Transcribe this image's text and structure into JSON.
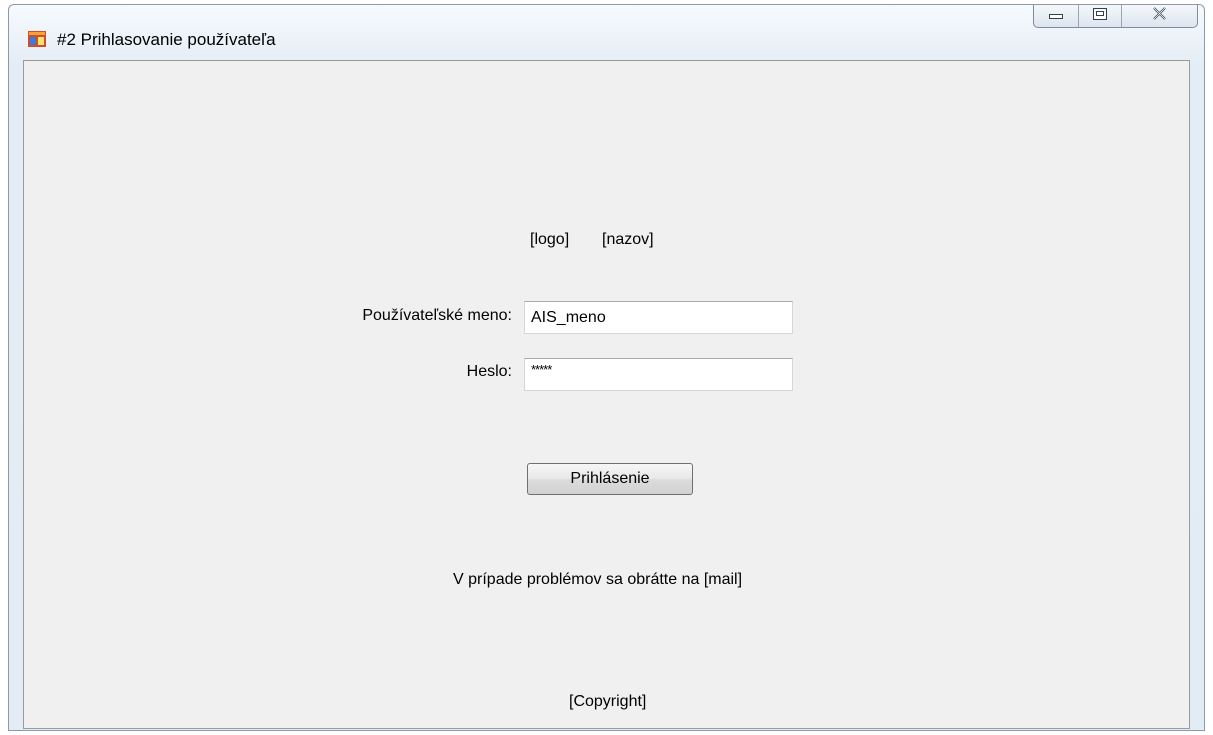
{
  "window": {
    "title": "#2 Prihlasovanie používateľa",
    "icon": "windows-form-icon",
    "caption_icons": [
      "minimize-icon",
      "maximize-icon",
      "close-icon"
    ]
  },
  "header": {
    "logo_text": "[logo]",
    "name_text": "[nazov]"
  },
  "form": {
    "username_label": "Používateľské meno:",
    "username_value": "AIS_meno",
    "password_label": "Heslo:",
    "password_value": "*****",
    "login_button": "Prihlásenie"
  },
  "footer": {
    "help_text": "V prípade problémov sa obrátte na [mail]",
    "copyright": "[Copyright]"
  },
  "colors": {
    "client_background": "#f0f0f0",
    "titlebar_top": "#f7fbff",
    "titlebar_bottom": "#e3ebf4"
  }
}
